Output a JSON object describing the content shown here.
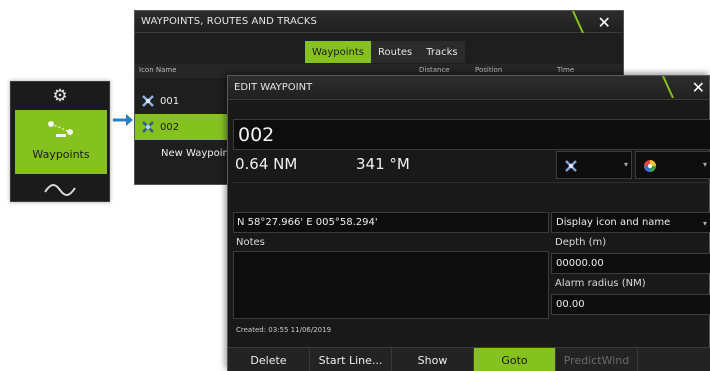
{
  "side_menu": {
    "items": [
      {
        "icon": "gear-icon"
      },
      {
        "icon": "waypoints-icon",
        "label": "Waypoints"
      },
      {
        "icon": "wave-icon"
      }
    ],
    "accent": "#86c21f"
  },
  "list_window": {
    "title": "WAYPOINTS, ROUTES AND TRACKS",
    "tabs": [
      "Waypoints",
      "Routes",
      "Tracks"
    ],
    "active_tab": "Waypoints",
    "columns": {
      "icon_name": "Icon Name",
      "distance": "Distance",
      "position": "Position",
      "time": "Time"
    },
    "rows": [
      {
        "name": "001",
        "selected": false
      },
      {
        "name": "002",
        "selected": true
      }
    ],
    "new_item": "New Waypoint..."
  },
  "edit_dialog": {
    "title": "EDIT WAYPOINT",
    "name": "002",
    "distance": "0.64 NM",
    "bearing": "341 °M",
    "position": "N 58°27.966'   E 005°58.294'",
    "notes_label": "Notes",
    "created": "Created: 03:55  11/06/2019",
    "display_option": "Display icon and name",
    "depth_label": "Depth (m)",
    "depth_value": "00000.00",
    "alarm_label": "Alarm radius (NM)",
    "alarm_value": "00.00",
    "buttons": {
      "delete": "Delete",
      "start_line": "Start Line...",
      "show": "Show",
      "goto": "Goto",
      "predictwind": "PredictWind"
    }
  },
  "colors": {
    "accent": "#86c21f",
    "window_bg": "#191919",
    "field_bg": "#0d0d0d",
    "title_slash": "#86c21f"
  }
}
